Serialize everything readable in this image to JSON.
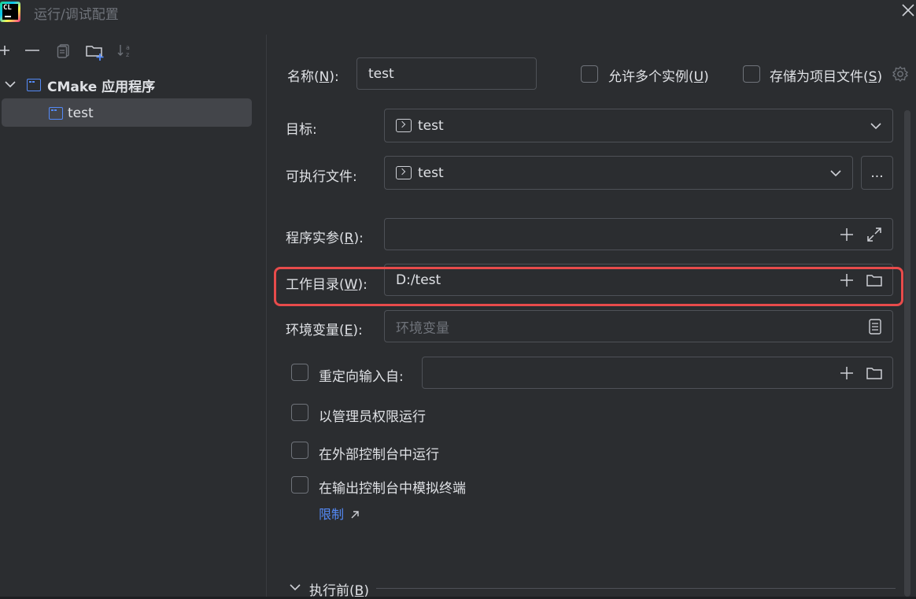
{
  "window": {
    "title": "运行/调试配置",
    "app_logo": "CL"
  },
  "toolbar": {
    "icons": [
      "add-icon",
      "remove-icon",
      "copy-icon",
      "new-folder-icon",
      "sort-icon"
    ]
  },
  "tree": {
    "root_label": "CMake 应用程序",
    "child_label": "test"
  },
  "form": {
    "name_label_pre": "名称(",
    "name_label_key": "N",
    "name_label_post": "):",
    "name_value": "test",
    "allow_multiple_pre": "允许多个实例(",
    "allow_multiple_key": "U",
    "allow_multiple_post": ")",
    "store_file_pre": "存储为项目文件(",
    "store_file_key": "S",
    "store_file_post": ")",
    "target_label": "目标:",
    "target_value": "test",
    "executable_label": "可执行文件:",
    "executable_value": "test",
    "browse_label": "...",
    "args_label_pre": "程序实参(",
    "args_label_key": "R",
    "args_label_post": "):",
    "args_value": "",
    "workdir_label_pre": "工作目录(",
    "workdir_label_key": "W",
    "workdir_label_post": "):",
    "workdir_value": "D:/test",
    "env_label_pre": "环境变量(",
    "env_label_key": "E",
    "env_label_post": "):",
    "env_placeholder": "环境变量",
    "redirect_label": "重定向输入自:",
    "admin_label": "以管理员权限运行",
    "external_console_label": "在外部控制台中运行",
    "emulate_terminal_label": "在输出控制台中模拟终端",
    "limit_link": "限制",
    "before_launch_pre": "执行前(",
    "before_launch_key": "B",
    "before_launch_post": ")"
  },
  "colors": {
    "accent": "#548af7",
    "highlight": "#e84b4b",
    "background": "#2b2d30"
  }
}
